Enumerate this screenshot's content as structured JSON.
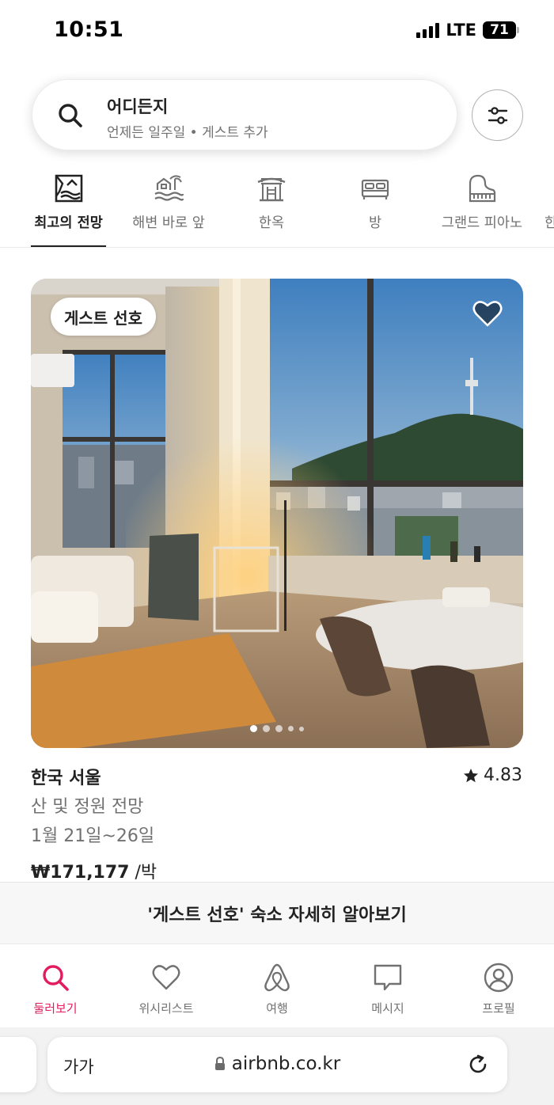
{
  "status": {
    "time": "10:51",
    "network": "LTE",
    "battery": "71"
  },
  "search": {
    "title": "어디든지",
    "subtitle": "언제든 일주일 • 게스트 추가"
  },
  "categories": [
    {
      "label": "최고의 전망",
      "icon": "mountain-view-icon",
      "active": true
    },
    {
      "label": "해변 바로 앞",
      "icon": "beachfront-icon"
    },
    {
      "label": "한옥",
      "icon": "hanok-icon"
    },
    {
      "label": "방",
      "icon": "room-bed-icon"
    },
    {
      "label": "그랜드 피아노",
      "icon": "grand-piano-icon"
    },
    {
      "label": "한"
    }
  ],
  "listing": {
    "badge": "게스트 선호",
    "title": "한국 서울",
    "rating": "4.83",
    "subtitle": "산 및 정원 전망",
    "dates": "1월 21일~26일",
    "price": "₩171,177",
    "price_unit": " /박",
    "photo_count": 5,
    "photo_index": 1
  },
  "banner": {
    "text": "'게스트 선호' 숙소 자세히 알아보기"
  },
  "nav": [
    {
      "label": "둘러보기",
      "icon": "search-icon",
      "active": true
    },
    {
      "label": "위시리스트",
      "icon": "heart-icon"
    },
    {
      "label": "여행",
      "icon": "airbnb-logo-icon"
    },
    {
      "label": "메시지",
      "icon": "message-icon"
    },
    {
      "label": "프로필",
      "icon": "profile-icon"
    }
  ],
  "browser": {
    "text_size_label": "가가",
    "url": "airbnb.co.kr"
  },
  "colors": {
    "accent": "#E31C5F",
    "text": "#222222",
    "muted": "#717171"
  }
}
